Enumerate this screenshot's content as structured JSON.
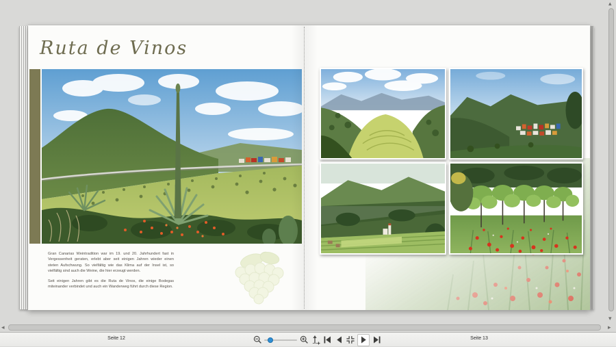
{
  "book": {
    "left_page": {
      "title": "Ruta de Vinos",
      "body_paragraphs": [
        "Gran Canarias Weintradition war im 19. und 20. Jahrhundert fast in Vergessenheit geraten, erlebt aber seit einigen Jahren wieder einen steten Aufschwung. So vielfältig wie das Klima auf der Insel ist, so vielfältig sind auch die Weine, die hier erzeugt werden.",
        "Seit einigen Jahren gibt es die Ruta de Vinos, die einige Bodegas miteinander verbindet und auch ein Wanderweg führt durch diese Region."
      ],
      "photo_alt": "hillside-with-agaves-and-village",
      "decor": [
        "olive-bar",
        "grapes-watermark"
      ]
    },
    "right_page": {
      "photo_alts": [
        "green-valley-meadow",
        "hillside-village-colorful-houses",
        "deep-valley-terraced-fields",
        "vineyard-rows-with-poppies"
      ],
      "decor": [
        "poppy-field-watermark"
      ]
    }
  },
  "statusbar": {
    "left_page_label": "Seite 12",
    "right_page_label": "Seite 13"
  },
  "toolbar_icons": {
    "zoom_out": "magnifier-minus",
    "zoom_in": "magnifier-plus",
    "zoom_fit": "arrow-up-plus",
    "first_page": "bar-triangle-left",
    "prev_page": "triangle-left",
    "fit_spread": "arrows-inward",
    "next_page": "triangle-right",
    "last_page": "triangle-right-bar"
  },
  "scrollbars": {
    "up": "▴",
    "down": "▾",
    "left": "◂",
    "right": "▸"
  },
  "colors": {
    "canvas_bg": "#d9d9d7",
    "page_bg": "#fcfcfa",
    "olive_bar": "#7d7a54",
    "title_text": "#6e6c50",
    "body_text": "#55504a",
    "slider_accent": "#2e8fd5"
  }
}
